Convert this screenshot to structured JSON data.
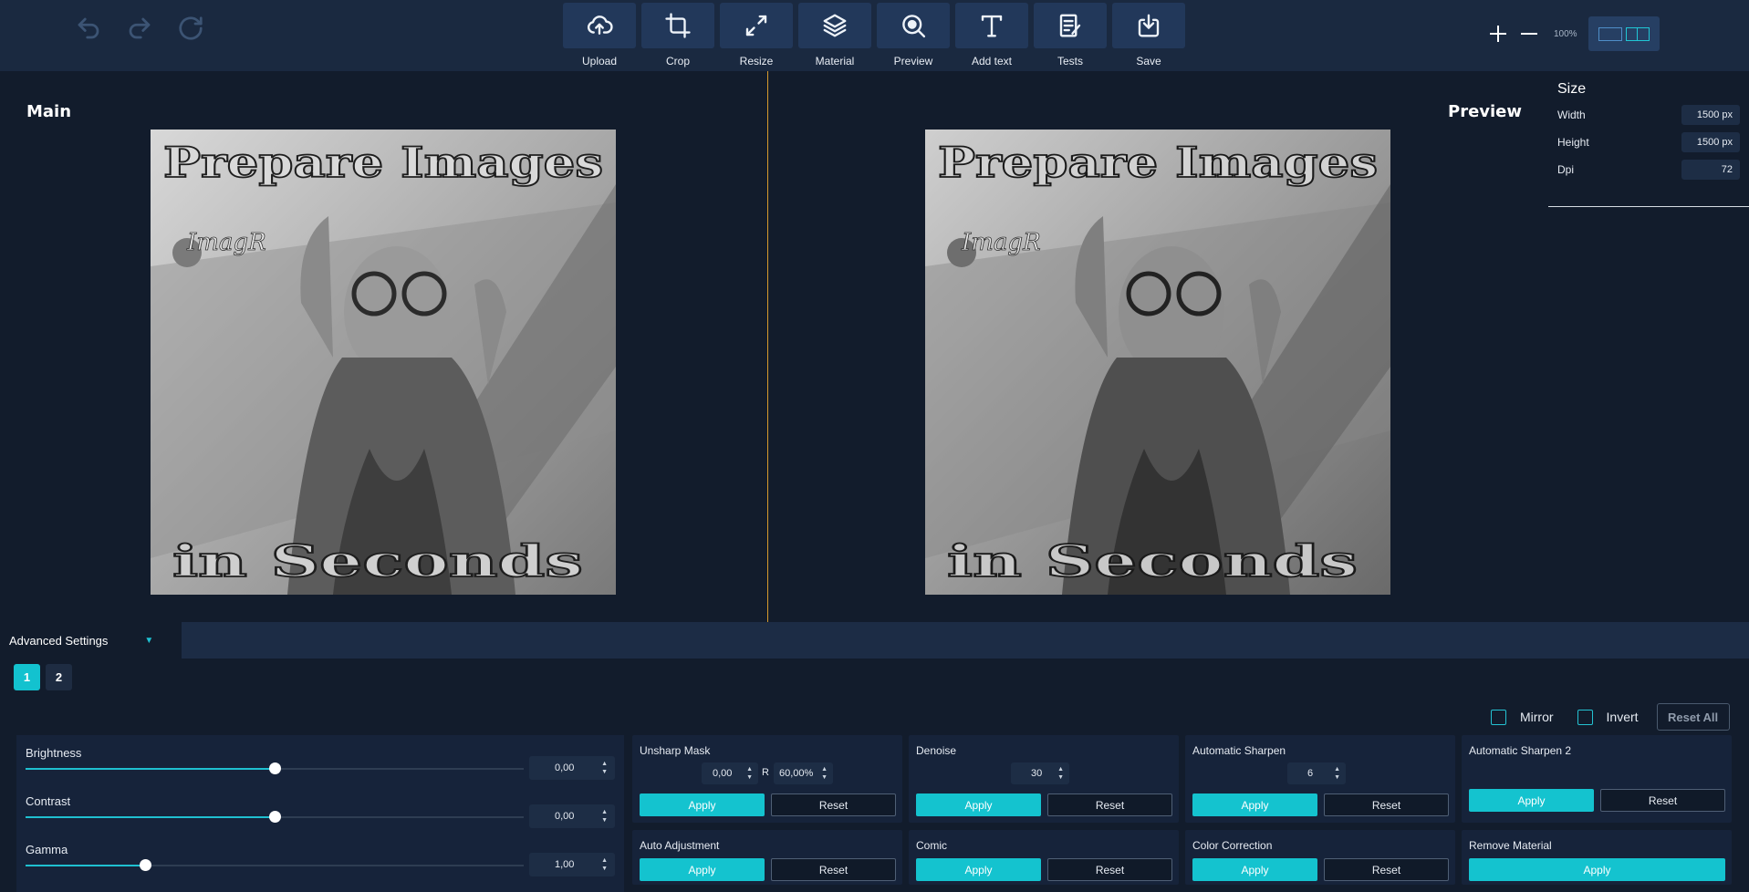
{
  "toolbar": {
    "tools": [
      {
        "label": "Upload",
        "icon": "upload-cloud-icon"
      },
      {
        "label": "Crop",
        "icon": "crop-icon"
      },
      {
        "label": "Resize",
        "icon": "resize-icon"
      },
      {
        "label": "Material",
        "icon": "layers-icon"
      },
      {
        "label": "Preview",
        "icon": "preview-search-icon"
      },
      {
        "label": "Add text",
        "icon": "text-icon"
      },
      {
        "label": "Tests",
        "icon": "checklist-icon"
      },
      {
        "label": "Save",
        "icon": "download-icon"
      }
    ],
    "zoom": "100%"
  },
  "canvas": {
    "main_title": "Main",
    "preview_title": "Preview",
    "image_text_top": "Prepare Images",
    "image_text_bottom": "in Seconds",
    "logo_text": "ImagR"
  },
  "size": {
    "title": "Size",
    "width_label": "Width",
    "width_value": "1500 px",
    "height_label": "Height",
    "height_value": "1500 px",
    "dpi_label": "Dpi",
    "dpi_value": "72"
  },
  "advanced": {
    "tab_label": "Advanced Settings",
    "pages": [
      "1",
      "2"
    ],
    "mirror_label": "Mirror",
    "invert_label": "Invert",
    "reset_all_label": "Reset All"
  },
  "adjustments": [
    {
      "label": "Brightness",
      "value": "0,00",
      "level": 0.5
    },
    {
      "label": "Contrast",
      "value": "0,00",
      "level": 0.5
    },
    {
      "label": "Gamma",
      "value": "1,00",
      "level": 0.24
    }
  ],
  "filters": {
    "apply_label": "Apply",
    "reset_label": "Reset",
    "unsharp": {
      "title": "Unsharp Mask",
      "amount": "0,00",
      "r_label": "R",
      "radius": "60,00%"
    },
    "denoise": {
      "title": "Denoise",
      "value": "30"
    },
    "auto_sharpen": {
      "title": "Automatic Sharpen",
      "value": "6"
    },
    "auto_sharpen2": {
      "title": "Automatic Sharpen 2"
    },
    "auto_adjust": {
      "title": "Auto Adjustment"
    },
    "comic": {
      "title": "Comic"
    },
    "color_correction": {
      "title": "Color Correction"
    },
    "remove_material": {
      "title": "Remove Material"
    }
  }
}
